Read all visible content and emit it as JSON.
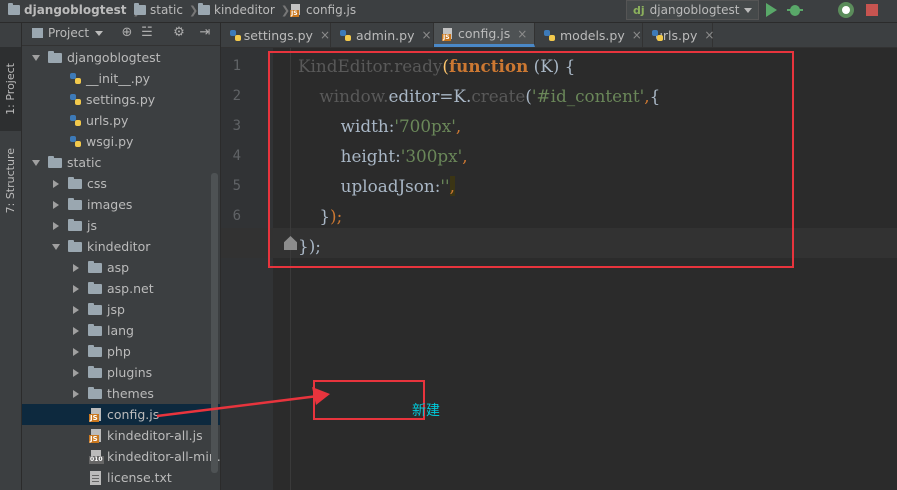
{
  "breadcrumbs": {
    "project": "djangoblogtest",
    "folder1": "static",
    "folder2": "kindeditor",
    "file": "config.js"
  },
  "toolbar": {
    "run_config_icon": "dj",
    "run_config": "djangoblogtest"
  },
  "side_tabs": {
    "project": "1: Project",
    "structure": "7: Structure"
  },
  "project_panel": {
    "title": "Project",
    "tree": [
      {
        "label": "djangoblogtest",
        "type": "folder",
        "open": true
      },
      {
        "label": "__init__.py",
        "type": "py"
      },
      {
        "label": "settings.py",
        "type": "py"
      },
      {
        "label": "urls.py",
        "type": "py"
      },
      {
        "label": "wsgi.py",
        "type": "py"
      },
      {
        "label": "static",
        "type": "folder",
        "open": true
      },
      {
        "label": "css",
        "type": "folder"
      },
      {
        "label": "images",
        "type": "folder"
      },
      {
        "label": "js",
        "type": "folder"
      },
      {
        "label": "kindeditor",
        "type": "folder",
        "open": true
      },
      {
        "label": "asp",
        "type": "folder"
      },
      {
        "label": "asp.net",
        "type": "folder"
      },
      {
        "label": "jsp",
        "type": "folder"
      },
      {
        "label": "lang",
        "type": "folder"
      },
      {
        "label": "php",
        "type": "folder"
      },
      {
        "label": "plugins",
        "type": "folder"
      },
      {
        "label": "themes",
        "type": "folder"
      },
      {
        "label": "config.js",
        "type": "js",
        "selected": true
      },
      {
        "label": "kindeditor-all.js",
        "type": "js"
      },
      {
        "label": "kindeditor-all-min.js",
        "type": "js-min"
      },
      {
        "label": "license.txt",
        "type": "txt"
      }
    ]
  },
  "tabs": [
    {
      "label": "settings.py"
    },
    {
      "label": "admin.py"
    },
    {
      "label": "config.js",
      "active": true
    },
    {
      "label": "models.py"
    },
    {
      "label": "urls.py"
    }
  ],
  "tab_close": "×",
  "editor": {
    "line_numbers": [
      "1",
      "2",
      "3",
      "4",
      "5",
      "6",
      "7"
    ],
    "lines": [
      [
        {
          "t": "KindEditor",
          "c": "dim"
        },
        {
          "t": ".",
          "c": "dim"
        },
        {
          "t": "ready",
          "c": "dim"
        },
        {
          "t": "(",
          "c": "fn"
        },
        {
          "t": "function",
          "c": "kw"
        },
        {
          "t": " (",
          "c": ""
        },
        {
          "t": "K",
          "c": ""
        },
        {
          "t": ") {",
          "c": ""
        }
      ],
      [
        {
          "t": "    window",
          "c": "dim"
        },
        {
          "t": ".",
          "c": "dim"
        },
        {
          "t": "editor",
          "c": ""
        },
        {
          "t": "=",
          "c": ""
        },
        {
          "t": "K",
          "c": ""
        },
        {
          "t": ".",
          "c": ""
        },
        {
          "t": "create",
          "c": "dim"
        },
        {
          "t": "(",
          "c": ""
        },
        {
          "t": "'#id_content'",
          "c": "str"
        },
        {
          "t": ",",
          "c": "punc"
        },
        {
          "t": "{",
          "c": ""
        }
      ],
      [
        {
          "t": "        width",
          "c": ""
        },
        {
          "t": ":",
          "c": ""
        },
        {
          "t": "'700px'",
          "c": "str"
        },
        {
          "t": ",",
          "c": "punc"
        }
      ],
      [
        {
          "t": "        height",
          "c": ""
        },
        {
          "t": ":",
          "c": ""
        },
        {
          "t": "'300px'",
          "c": "str"
        },
        {
          "t": ",",
          "c": "punc"
        }
      ],
      [
        {
          "t": "        uploadJson",
          "c": ""
        },
        {
          "t": ":",
          "c": ""
        },
        {
          "t": "''",
          "c": "str"
        },
        {
          "t": ",",
          "c": "punc hl"
        }
      ],
      [
        {
          "t": "    }",
          "c": ""
        },
        {
          "t": ");",
          "c": "punc"
        }
      ],
      [
        {
          "t": "}",
          "c": ""
        },
        {
          "t": ");",
          "c": ""
        }
      ]
    ]
  },
  "annotation": {
    "new_label": "新建",
    "color": "#e8343d"
  },
  "colors": {
    "background": "#2b2b2b",
    "panel": "#3c3f41",
    "keyword": "#cc7832",
    "string": "#6a8759",
    "selection": "#0d293e"
  }
}
